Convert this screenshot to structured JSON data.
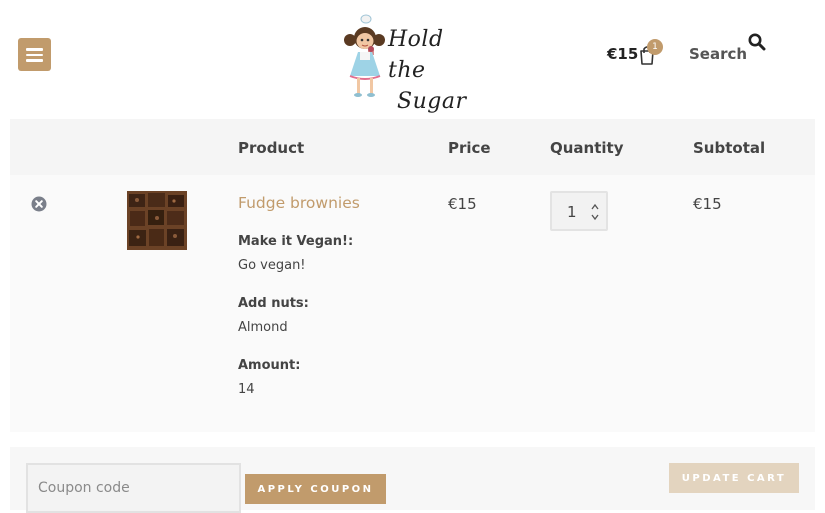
{
  "header": {
    "logo_line1": "Hold the",
    "logo_line2": "Sugar",
    "cart_total": "€15",
    "cart_count": "1",
    "search_label": "Search"
  },
  "table": {
    "headers": {
      "product": "Product",
      "price": "Price",
      "quantity": "Quantity",
      "subtotal": "Subtotal"
    },
    "items": [
      {
        "name": "Fudge brownies",
        "price": "€15",
        "quantity": "1",
        "subtotal": "€15",
        "meta": [
          {
            "key": "Make it Vegan!:",
            "value": "Go vegan!"
          },
          {
            "key": "Add nuts:",
            "value": "Almond"
          },
          {
            "key": "Amount:",
            "value": "14"
          }
        ]
      }
    ]
  },
  "actions": {
    "coupon_placeholder": "Coupon code",
    "apply_coupon_label": "APPLY COUPON",
    "update_cart_label": "UPDATE CART"
  },
  "colors": {
    "accent": "#c19b6c",
    "accent_light": "#e3d4bf",
    "table_bg": "#fafafa",
    "header_bg": "#f5f5f5"
  },
  "icons": {
    "menu": "hamburger-menu-icon",
    "cart": "shopping-bag-icon",
    "search": "search-icon",
    "remove": "remove-circle-x-icon"
  }
}
